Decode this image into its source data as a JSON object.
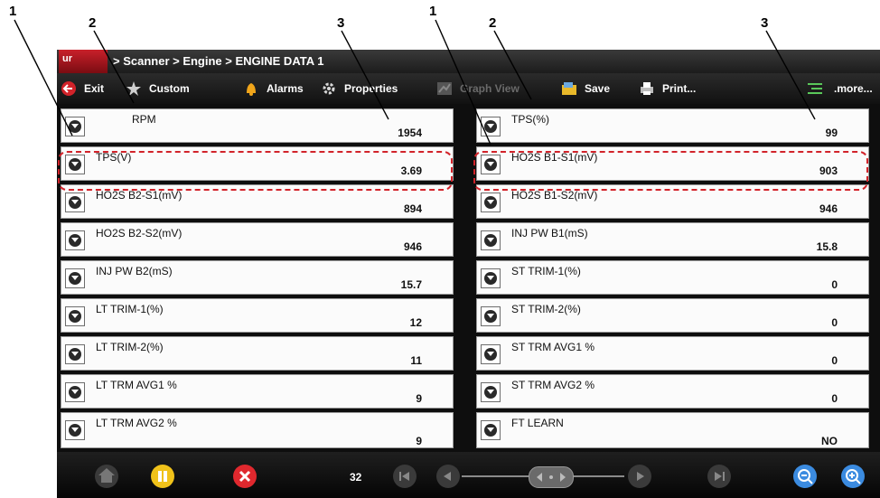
{
  "callouts": [
    "1",
    "2",
    "3",
    "1",
    "2",
    "3"
  ],
  "header": {
    "app_icon_text": "ur",
    "breadcrumb": "> Scanner  > Engine  > ENGINE DATA 1"
  },
  "toolbar": {
    "exit": "Exit",
    "custom": "Custom",
    "alarms": "Alarms",
    "properties": "Properties",
    "graph_view": "Graph View",
    "save": "Save",
    "print": "Print...",
    "more": ".more..."
  },
  "left_rows": [
    {
      "label": "RPM",
      "value": "1954"
    },
    {
      "label": "TPS(V)",
      "value": "3.69"
    },
    {
      "label": "HO2S B2-S1(mV)",
      "value": "894"
    },
    {
      "label": "HO2S B2-S2(mV)",
      "value": "946"
    },
    {
      "label": "INJ PW B2(mS)",
      "value": "15.7"
    },
    {
      "label": "LT TRIM-1(%)",
      "value": "12"
    },
    {
      "label": "LT TRIM-2(%)",
      "value": "11"
    },
    {
      "label": "LT TRM AVG1 %",
      "value": "9"
    },
    {
      "label": "LT TRM AVG2 %",
      "value": "9"
    }
  ],
  "right_rows": [
    {
      "label": "TPS(%)",
      "value": "99"
    },
    {
      "label": "HO2S B1-S1(mV)",
      "value": "903"
    },
    {
      "label": "HO2S B1-S2(mV)",
      "value": "946"
    },
    {
      "label": "INJ PW B1(mS)",
      "value": "15.8"
    },
    {
      "label": "ST TRIM-1(%)",
      "value": "0"
    },
    {
      "label": "ST TRIM-2(%)",
      "value": "0"
    },
    {
      "label": "ST TRM AVG1 %",
      "value": "0"
    },
    {
      "label": "ST TRM AVG2 %",
      "value": "0"
    },
    {
      "label": "FT LEARN",
      "value": "NO"
    }
  ],
  "bottom": {
    "page_number": "32"
  },
  "colors": {
    "highlight": "#d2232a",
    "pause": "#f0c21a",
    "stop": "#e0282e",
    "zoom": "#3b8be0"
  }
}
